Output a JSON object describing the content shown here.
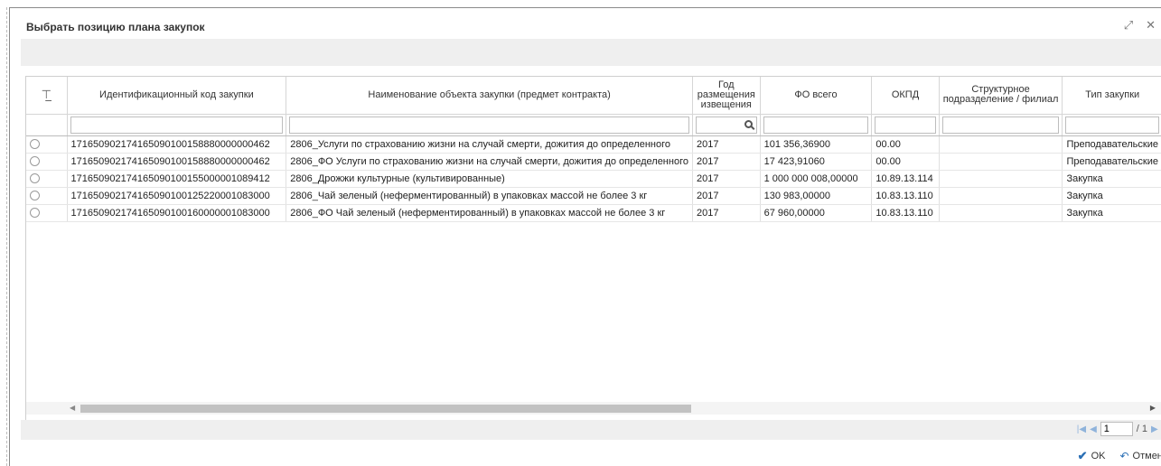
{
  "dialog": {
    "title": "Выбрать позицию плана закупок",
    "icons": [
      "expand-icon",
      "close-icon"
    ]
  },
  "table": {
    "columns": [
      "Идентификационный код закупки",
      "Наименование объекта закупки (предмет контракта)",
      "Год размещения извещения",
      "ФО всего",
      "ОКПД",
      "Структурное подразделение / филиал",
      "Тип закупки"
    ],
    "rows": [
      [
        "171650902174165090100158880000000462",
        "2806_Услуги по страхованию жизни на случай смерти, дожития до определенного",
        "2017",
        "101 356,36900",
        "00.00",
        "",
        "Преподавательские"
      ],
      [
        "171650902174165090100158880000000462",
        "2806_ФО Услуги по страхованию жизни на случай смерти, дожития до определенного",
        "2017",
        "17 423,91060",
        "00.00",
        "",
        "Преподавательские"
      ],
      [
        "171650902174165090100155000001089412",
        "2806_Дрожжи культурные (культивированные)",
        "2017",
        "1 000 000 008,00000",
        "10.89.13.114",
        "",
        "Закупка"
      ],
      [
        "171650902174165090100125220001083000",
        "2806_Чай зеленый (неферментированный) в упаковках массой не более 3 кг",
        "2017",
        "130 983,00000",
        "10.83.13.110",
        "",
        "Закупка"
      ],
      [
        "171650902174165090100160000001083000",
        "2806_ФО Чай зеленый (неферментированный) в упаковках массой не более 3 кг",
        "2017",
        "67 960,00000",
        "10.83.13.110",
        "",
        "Закупка"
      ]
    ]
  },
  "pager": {
    "current_page": "1",
    "total": "/ 1"
  },
  "actions": {
    "ok_label": "OK",
    "cancel_label": "Отмена"
  }
}
